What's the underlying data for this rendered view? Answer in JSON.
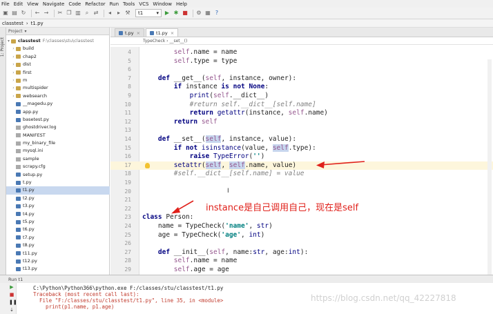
{
  "menubar": [
    "File",
    "Edit",
    "View",
    "Navigate",
    "Code",
    "Refactor",
    "Run",
    "Tools",
    "VCS",
    "Window",
    "Help"
  ],
  "toolbar": {
    "run_config": "t1"
  },
  "navbar": {
    "crumbs": [
      "classtest",
      "t1.py"
    ]
  },
  "left_strip": {
    "label": "1: Project"
  },
  "project": {
    "header": "Project",
    "root": {
      "name": "classtest",
      "path": "F:\\classes\\stu\\classtest"
    },
    "items": [
      {
        "name": "build",
        "kind": "folder"
      },
      {
        "name": "chap2",
        "kind": "folder"
      },
      {
        "name": "dist",
        "kind": "folder"
      },
      {
        "name": "first",
        "kind": "folder"
      },
      {
        "name": "m",
        "kind": "folder"
      },
      {
        "name": "multispider",
        "kind": "folder"
      },
      {
        "name": "websearch",
        "kind": "folder"
      },
      {
        "name": "__magedu.py",
        "kind": "py"
      },
      {
        "name": "app.py",
        "kind": "py"
      },
      {
        "name": "basetest.py",
        "kind": "py"
      },
      {
        "name": "ghostdriver.log",
        "kind": "file"
      },
      {
        "name": "MANIFEST",
        "kind": "file"
      },
      {
        "name": "my_binary_file",
        "kind": "file"
      },
      {
        "name": "mysql.ini",
        "kind": "file"
      },
      {
        "name": "sample",
        "kind": "file"
      },
      {
        "name": "scrapy.cfg",
        "kind": "file"
      },
      {
        "name": "setup.py",
        "kind": "py"
      },
      {
        "name": "t.py",
        "kind": "py"
      },
      {
        "name": "t1.py",
        "kind": "py",
        "selected": true
      },
      {
        "name": "t2.py",
        "kind": "py"
      },
      {
        "name": "t3.py",
        "kind": "py"
      },
      {
        "name": "t4.py",
        "kind": "py"
      },
      {
        "name": "t5.py",
        "kind": "py"
      },
      {
        "name": "t6.py",
        "kind": "py"
      },
      {
        "name": "t7.py",
        "kind": "py"
      },
      {
        "name": "t8.py",
        "kind": "py"
      },
      {
        "name": "t11.py",
        "kind": "py"
      },
      {
        "name": "t12.py",
        "kind": "py"
      },
      {
        "name": "t13.py",
        "kind": "py"
      }
    ]
  },
  "editor": {
    "tabs": [
      {
        "label": "t.py"
      },
      {
        "label": "t1.py",
        "active": true
      }
    ],
    "breadcrumb": "TypeCheck  ›  __set__()",
    "lines": [
      {
        "n": "4",
        "t": "        self.name = name"
      },
      {
        "n": "5",
        "t": "        self.type = type"
      },
      {
        "n": "6",
        "t": ""
      },
      {
        "n": "7",
        "t": "    def __get__(self, instance, owner):"
      },
      {
        "n": "8",
        "t": "        if instance is not None:"
      },
      {
        "n": "9",
        "t": "            print(self.__dict__)"
      },
      {
        "n": "10",
        "t": "            #return self.__dict__[self.name]"
      },
      {
        "n": "11",
        "t": "            return getattr(instance, self.name)"
      },
      {
        "n": "12",
        "t": "        return self"
      },
      {
        "n": "13",
        "t": ""
      },
      {
        "n": "14",
        "t": "    def __set__(self, instance, value):"
      },
      {
        "n": "15",
        "t": "        if not isinstance(value, self.type):"
      },
      {
        "n": "16",
        "t": "            raise TypeError('')"
      },
      {
        "n": "17",
        "t": "        setattr(self, self.name, value)"
      },
      {
        "n": "18",
        "t": "        #self.__dict__[self.name] = value"
      },
      {
        "n": "19",
        "t": ""
      },
      {
        "n": "20",
        "t": ""
      },
      {
        "n": "21",
        "t": ""
      },
      {
        "n": "22",
        "t": ""
      },
      {
        "n": "23",
        "t": "class Person:"
      },
      {
        "n": "24",
        "t": "    name = TypeCheck('name', str)"
      },
      {
        "n": "25",
        "t": "    age = TypeCheck('age', int)"
      },
      {
        "n": "26",
        "t": ""
      },
      {
        "n": "27",
        "t": "    def __init__(self, name:str, age:int):"
      },
      {
        "n": "28",
        "t": "        self.name = name"
      },
      {
        "n": "29",
        "t": "        self.age = age"
      }
    ],
    "annotation": "instance是自己调用自己，现在是self"
  },
  "run": {
    "header": "Run  t1",
    "lines": [
      {
        "t": "C:\\Python\\Python366\\python.exe F:/classes/stu/classtest/t1.py",
        "style": "plain"
      },
      {
        "t": "Traceback (most recent call last):",
        "style": "err"
      },
      {
        "pre": "  File \"",
        "link": "F:/classes/stu/classtest/t1.py",
        "post": "\", line 35, in <module>",
        "style": "err"
      },
      {
        "t": "    print(p1.name, p1.age)",
        "style": "err"
      }
    ]
  },
  "watermark": "https://blog.csdn.net/qq_42227818"
}
